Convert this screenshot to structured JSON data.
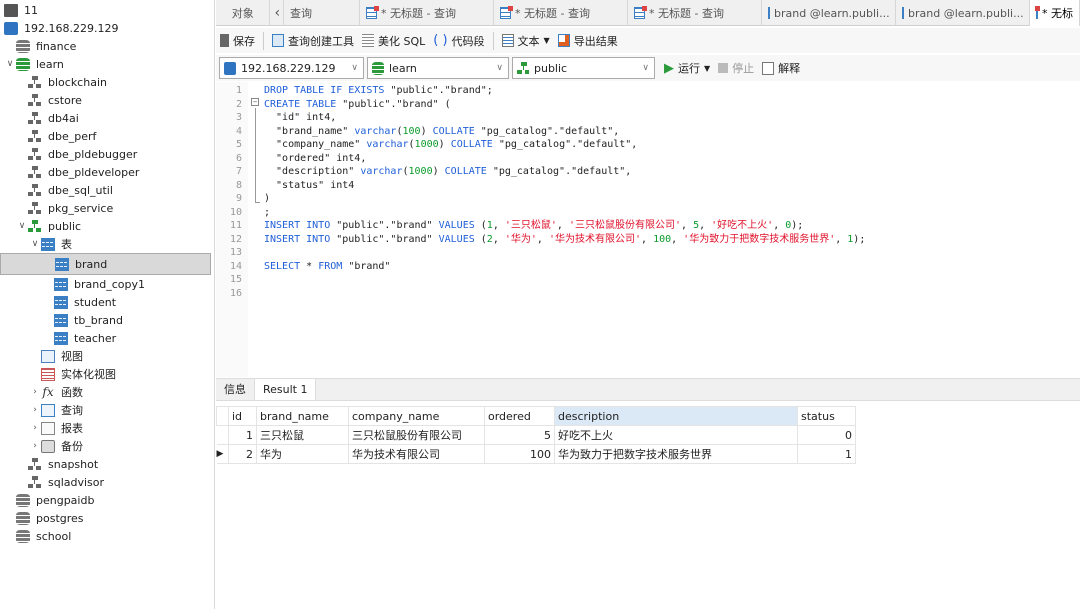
{
  "sidebar": {
    "items": [
      {
        "label": "11",
        "level": 0,
        "icon": "conn",
        "chev": ""
      },
      {
        "label": "192.168.229.129",
        "level": 0,
        "icon": "pg",
        "chev": ""
      },
      {
        "label": "finance",
        "level": 1,
        "icon": "db",
        "chev": ""
      },
      {
        "label": "learn",
        "level": 1,
        "icon": "db green",
        "chev": "open"
      },
      {
        "label": "blockchain",
        "level": 2,
        "icon": "schema",
        "chev": ""
      },
      {
        "label": "cstore",
        "level": 2,
        "icon": "schema",
        "chev": ""
      },
      {
        "label": "db4ai",
        "level": 2,
        "icon": "schema",
        "chev": ""
      },
      {
        "label": "dbe_perf",
        "level": 2,
        "icon": "schema",
        "chev": ""
      },
      {
        "label": "dbe_pldebugger",
        "level": 2,
        "icon": "schema",
        "chev": ""
      },
      {
        "label": "dbe_pldeveloper",
        "level": 2,
        "icon": "schema",
        "chev": ""
      },
      {
        "label": "dbe_sql_util",
        "level": 2,
        "icon": "schema",
        "chev": ""
      },
      {
        "label": "pkg_service",
        "level": 2,
        "icon": "schema",
        "chev": ""
      },
      {
        "label": "public",
        "level": 2,
        "icon": "schema green",
        "chev": "open"
      },
      {
        "label": "表",
        "level": 3,
        "icon": "table",
        "chev": "open"
      },
      {
        "label": "brand",
        "level": 4,
        "icon": "table",
        "chev": "",
        "selected": true
      },
      {
        "label": "brand_copy1",
        "level": 4,
        "icon": "table",
        "chev": ""
      },
      {
        "label": "student",
        "level": 4,
        "icon": "table",
        "chev": ""
      },
      {
        "label": "tb_brand",
        "level": 4,
        "icon": "table",
        "chev": ""
      },
      {
        "label": "teacher",
        "level": 4,
        "icon": "table",
        "chev": ""
      },
      {
        "label": "视图",
        "level": 3,
        "icon": "view",
        "chev": ""
      },
      {
        "label": "实体化视图",
        "level": 3,
        "icon": "mview",
        "chev": ""
      },
      {
        "label": "函数",
        "level": 3,
        "icon": "func",
        "chev": "closed"
      },
      {
        "label": "查询",
        "level": 3,
        "icon": "query",
        "chev": "closed"
      },
      {
        "label": "报表",
        "level": 3,
        "icon": "report",
        "chev": "closed"
      },
      {
        "label": "备份",
        "level": 3,
        "icon": "backup",
        "chev": "closed"
      },
      {
        "label": "snapshot",
        "level": 2,
        "icon": "schema",
        "chev": ""
      },
      {
        "label": "sqladvisor",
        "level": 2,
        "icon": "schema",
        "chev": ""
      },
      {
        "label": "pengpaidb",
        "level": 1,
        "icon": "db",
        "chev": ""
      },
      {
        "label": "postgres",
        "level": 1,
        "icon": "db",
        "chev": ""
      },
      {
        "label": "school",
        "level": 1,
        "icon": "db",
        "chev": ""
      }
    ]
  },
  "tabs": {
    "objects": "对象",
    "back": "‹",
    "items": [
      {
        "label": "查询",
        "icon": "none"
      },
      {
        "label": "* 无标题 - 查询",
        "icon": "query"
      },
      {
        "label": "* 无标题 - 查询",
        "icon": "query"
      },
      {
        "label": "* 无标题 - 查询",
        "icon": "query"
      },
      {
        "label": "brand @learn.publi...",
        "icon": "table"
      },
      {
        "label": "brand @learn.publi...",
        "icon": "table"
      },
      {
        "label": "* 无标",
        "icon": "query",
        "active": true
      }
    ]
  },
  "toolbar": {
    "save": "保存",
    "query_builder": "查询创建工具",
    "beautify": "美化 SQL",
    "snippet": "代码段",
    "text": "文本",
    "export": "导出结果"
  },
  "selectors": {
    "connection": "192.168.229.129",
    "database": "learn",
    "schema": "public",
    "run": "运行",
    "stop": "停止",
    "explain": "解释"
  },
  "editor": {
    "lines": [
      [
        [
          "kw",
          "DROP TABLE IF EXISTS "
        ],
        [
          "txt",
          "\"public\".\"brand\";"
        ]
      ],
      [
        [
          "kw",
          "CREATE TABLE "
        ],
        [
          "txt",
          "\"public\".\"brand\" ("
        ]
      ],
      [
        [
          "txt",
          "  \"id\" int4,"
        ]
      ],
      [
        [
          "txt",
          "  \"brand_name\" "
        ],
        [
          "kw",
          "varchar"
        ],
        [
          "txt",
          "("
        ],
        [
          "num",
          "100"
        ],
        [
          "txt",
          ") "
        ],
        [
          "kw",
          "COLLATE "
        ],
        [
          "txt",
          "\"pg_catalog\".\"default\","
        ]
      ],
      [
        [
          "txt",
          "  \"company_name\" "
        ],
        [
          "kw",
          "varchar"
        ],
        [
          "txt",
          "("
        ],
        [
          "num",
          "1000"
        ],
        [
          "txt",
          ") "
        ],
        [
          "kw",
          "COLLATE "
        ],
        [
          "txt",
          "\"pg_catalog\".\"default\","
        ]
      ],
      [
        [
          "txt",
          "  \"ordered\" int4,"
        ]
      ],
      [
        [
          "txt",
          "  \"description\" "
        ],
        [
          "kw",
          "varchar"
        ],
        [
          "txt",
          "("
        ],
        [
          "num",
          "1000"
        ],
        [
          "txt",
          ") "
        ],
        [
          "kw",
          "COLLATE "
        ],
        [
          "txt",
          "\"pg_catalog\".\"default\","
        ]
      ],
      [
        [
          "txt",
          "  \"status\" int4"
        ]
      ],
      [
        [
          "txt",
          ")"
        ]
      ],
      [
        [
          "txt",
          ";"
        ]
      ],
      [
        [
          "kw",
          "INSERT INTO "
        ],
        [
          "txt",
          "\"public\".\"brand\" "
        ],
        [
          "kw",
          "VALUES "
        ],
        [
          "txt",
          "("
        ],
        [
          "num",
          "1"
        ],
        [
          "txt",
          ", "
        ],
        [
          "str",
          "'三只松鼠'"
        ],
        [
          "txt",
          ", "
        ],
        [
          "str",
          "'三只松鼠股份有限公司'"
        ],
        [
          "txt",
          ", "
        ],
        [
          "num",
          "5"
        ],
        [
          "txt",
          ", "
        ],
        [
          "str",
          "'好吃不上火'"
        ],
        [
          "txt",
          ", "
        ],
        [
          "num",
          "0"
        ],
        [
          "txt",
          ");"
        ]
      ],
      [
        [
          "kw",
          "INSERT INTO "
        ],
        [
          "txt",
          "\"public\".\"brand\" "
        ],
        [
          "kw",
          "VALUES "
        ],
        [
          "txt",
          "("
        ],
        [
          "num",
          "2"
        ],
        [
          "txt",
          ", "
        ],
        [
          "str",
          "'华为'"
        ],
        [
          "txt",
          ", "
        ],
        [
          "str",
          "'华为技术有限公司'"
        ],
        [
          "txt",
          ", "
        ],
        [
          "num",
          "100"
        ],
        [
          "txt",
          ", "
        ],
        [
          "str",
          "'华为致力于把数字技术服务世界'"
        ],
        [
          "txt",
          ", "
        ],
        [
          "num",
          "1"
        ],
        [
          "txt",
          ");"
        ]
      ],
      [],
      [
        [
          "kw",
          "SELECT "
        ],
        [
          "txt",
          "* "
        ],
        [
          "kw",
          "FROM "
        ],
        [
          "txt",
          "\"brand\""
        ]
      ],
      [],
      []
    ]
  },
  "results": {
    "tabs": [
      "信息",
      "Result 1"
    ],
    "columns": [
      "id",
      "brand_name",
      "company_name",
      "ordered",
      "description",
      "status"
    ],
    "rows": [
      [
        "1",
        "三只松鼠",
        "三只松鼠股份有限公司",
        "5",
        "好吃不上火",
        "0"
      ],
      [
        "2",
        "华为",
        "华为技术有限公司",
        "100",
        "华为致力于把数字技术服务世界",
        "1"
      ]
    ],
    "current_row_marker": "▶"
  }
}
